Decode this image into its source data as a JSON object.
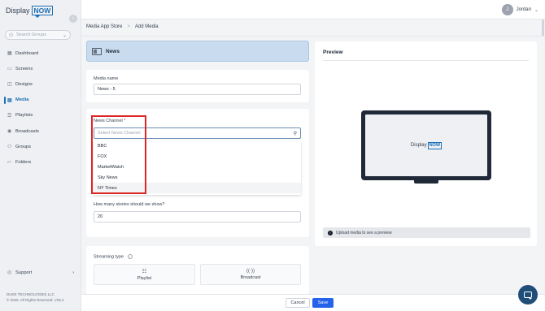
{
  "brand": {
    "text": "Display",
    "badge": "NOW"
  },
  "sidebar": {
    "search_placeholder": "Search Groups",
    "items": [
      {
        "label": "Dashboard",
        "icon": "grid-icon"
      },
      {
        "label": "Screens",
        "icon": "screen-icon"
      },
      {
        "label": "Designs",
        "icon": "design-icon"
      },
      {
        "label": "Media",
        "icon": "media-icon",
        "active": true
      },
      {
        "label": "Playlists",
        "icon": "playlist-icon"
      },
      {
        "label": "Broadcasts",
        "icon": "broadcast-icon"
      },
      {
        "label": "Groups",
        "icon": "groups-icon"
      },
      {
        "label": "Folders",
        "icon": "folder-icon"
      }
    ],
    "support_label": "Support",
    "footer_company": "DUKE TECHNOLOGIES LLC",
    "footer_copyright": "© 2025. All Rights Reserved. V25.2"
  },
  "user": {
    "initial": "J",
    "name": "Jordan"
  },
  "breadcrumb": {
    "parent": "Media App Store",
    "separator": ">",
    "current": "Add Media"
  },
  "banner": {
    "title": "News"
  },
  "media_name": {
    "label": "Media name",
    "value": "News - 5"
  },
  "news_channel": {
    "label": "News Channel",
    "required_mark": "*",
    "placeholder": "Select News Channel",
    "options": [
      "BBC",
      "FOX",
      "MarketWatch",
      "Sky News",
      "NY Times"
    ]
  },
  "stories": {
    "label": "How many stories should we show?",
    "value": "20"
  },
  "streaming": {
    "label": "Streaming type",
    "options": [
      "Playlist",
      "Broadcast"
    ]
  },
  "preview": {
    "title": "Preview",
    "note": "Upload media to see a preview",
    "logo_text": "Display",
    "logo_badge": "NOW"
  },
  "actions": {
    "cancel": "Cancel",
    "save": "Save"
  },
  "colors": {
    "accent": "#1a6fb5",
    "save_button": "#2563eb",
    "highlight": "#dc2626",
    "banner": "#c9dcef"
  }
}
